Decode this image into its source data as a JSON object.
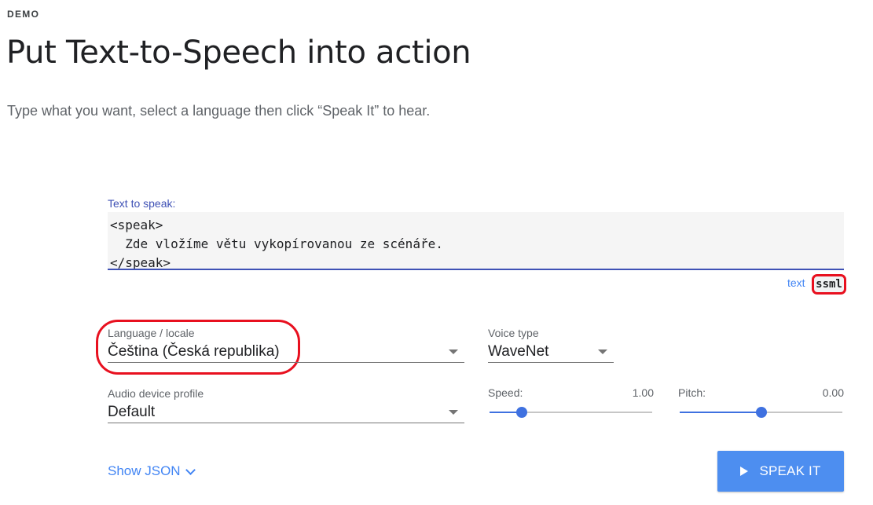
{
  "header": {
    "eyebrow": "DEMO",
    "title": "Put Text-to-Speech into action",
    "subtitle": "Type what you want, select a language then click “Speak It” to hear."
  },
  "text_input": {
    "label": "Text to speak:",
    "value": "<speak>\n  Zde vložíme větu vykopírovanou ze scénáře.\n</speak>"
  },
  "mode_toggle": {
    "text_label": "text",
    "ssml_label": "ssml",
    "selected": "ssml"
  },
  "language": {
    "label": "Language / locale",
    "value": "Čeština (Česká republika)"
  },
  "voice_type": {
    "label": "Voice type",
    "value": "WaveNet"
  },
  "audio_profile": {
    "label": "Audio device profile",
    "value": "Default"
  },
  "speed": {
    "label": "Speed:",
    "value": "1.00",
    "level": 0.2
  },
  "pitch": {
    "label": "Pitch:",
    "value": "0.00",
    "level": 0.5
  },
  "actions": {
    "show_json": "Show JSON",
    "speak_it": "SPEAK IT"
  },
  "colors": {
    "accent": "#4285f4",
    "focus": "#3f51b5",
    "highlight": "#e8101f",
    "button": "#4d8ef0"
  },
  "icons": {
    "dropdown": "caret-down-icon",
    "show_json": "chevron-down-icon",
    "speak": "play-icon"
  }
}
